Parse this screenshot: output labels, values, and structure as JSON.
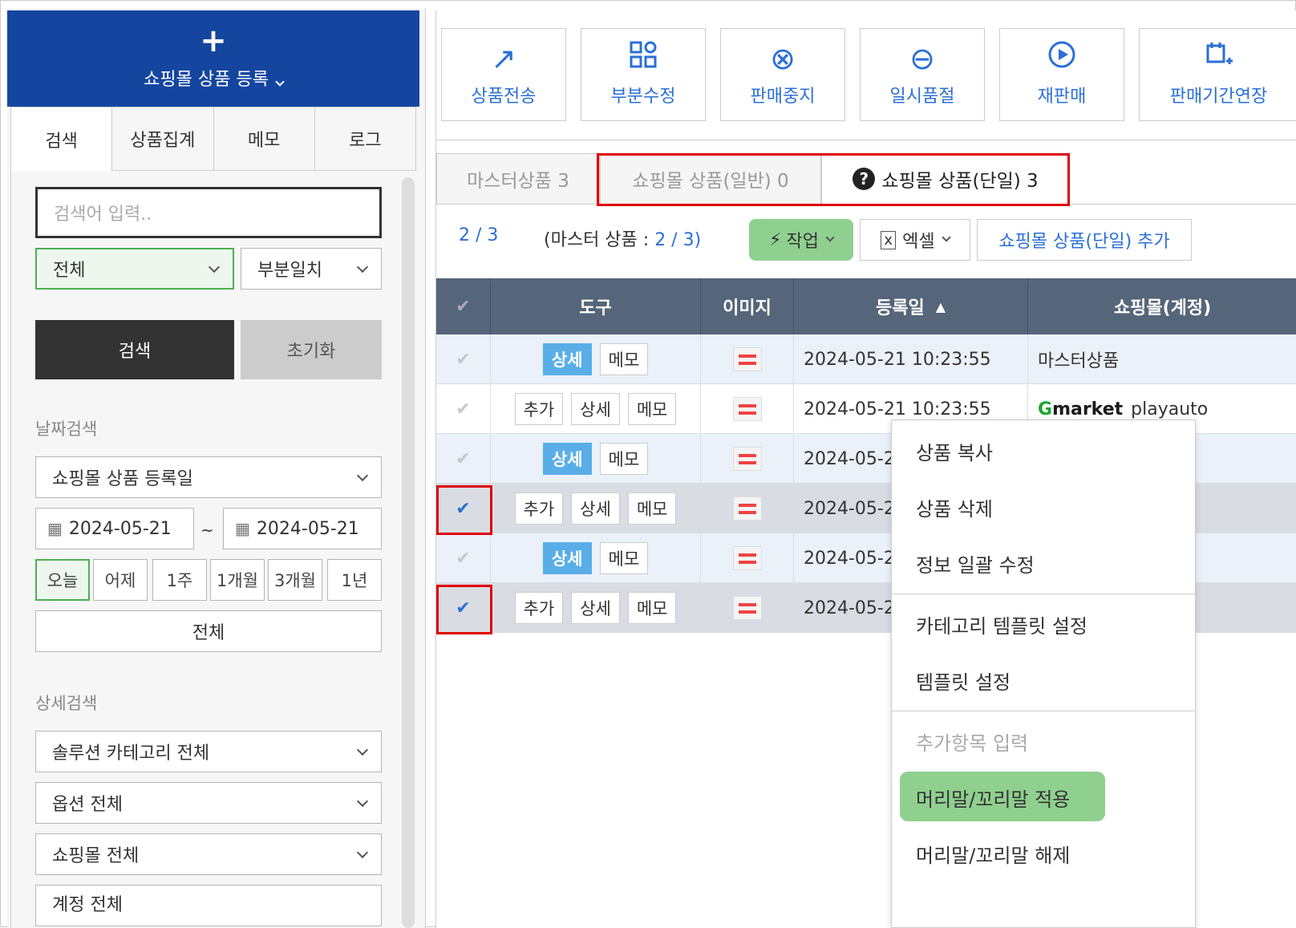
{
  "left": {
    "register_icon": "plus-icon",
    "register_label": "쇼핑몰 상품 등록",
    "tabs": [
      "검색",
      "상품집계",
      "메모",
      "로그"
    ],
    "search_placeholder": "검색어 입력..",
    "select_scope": "전체",
    "select_match": "부분일치",
    "btn_search": "검색",
    "btn_reset": "초기화",
    "date_section": "날짜검색",
    "date_type": "쇼핑몰 상품 등록일",
    "date_from": "2024-05-21",
    "date_sep": "~",
    "date_to": "2024-05-21",
    "quick_dates": [
      "오늘",
      "어제",
      "1주",
      "1개월",
      "3개월",
      "1년"
    ],
    "quick_all": "전체",
    "detail_section": "상세검색",
    "filters": [
      "솔루션 카테고리 전체",
      "옵션 전체",
      "쇼핑몰 전체",
      "계정 전체"
    ]
  },
  "toolbar": [
    {
      "label": "상품전송",
      "icon": "arrow-up-right-icon"
    },
    {
      "label": "부분수정",
      "icon": "grid-edit-icon"
    },
    {
      "label": "판매중지",
      "icon": "circle-x-icon"
    },
    {
      "label": "일시품절",
      "icon": "circle-minus-icon"
    },
    {
      "label": "재판매",
      "icon": "circle-play-icon"
    },
    {
      "label": "판매기간연장",
      "icon": "calendar-plus-icon"
    }
  ],
  "product_tabs": [
    "마스터상품 3",
    "쇼핑몰 상품(일반) 0",
    "쇼핑몰 상품(단일) 3"
  ],
  "info": {
    "count": "2 / 3",
    "master_prefix": "(마스터 상품 : ",
    "master_count": "2 / 3)",
    "work": "작업",
    "excel": "엑셀",
    "add_single": "쇼핑몰 상품(단일) 추가"
  },
  "table": {
    "headers": [
      "도구",
      "이미지",
      "등록일",
      "쇼핑몰(계정)"
    ],
    "btn_add": "추가",
    "btn_detail": "상세",
    "btn_memo": "메모",
    "rows": [
      {
        "date": "2024-05-21 10:23:55",
        "mall": "마스터상품",
        "checked": false
      },
      {
        "date": "2024-05-21 10:23:55",
        "mall_logo": "market",
        "mall_logo_g": "G",
        "mall_account": "playauto",
        "checked": false
      },
      {
        "date": "2024-05-21",
        "checked": false
      },
      {
        "date": "2024-05-21",
        "checked": true
      },
      {
        "date": "2024-05-21",
        "checked": false
      },
      {
        "date": "2024-05-21",
        "checked": true
      }
    ]
  },
  "menu": {
    "items": [
      "상품 복사",
      "상품 삭제",
      "정보 일괄 수정",
      "카테고리 템플릿 설정",
      "템플릿 설정",
      "추가항목 입력",
      "머리말/꼬리말 적용",
      "머리말/꼬리말 해제"
    ]
  },
  "colors": {
    "primary": "#1446a0",
    "accent": "#2b6fd6",
    "highlight": "#8fd08f",
    "header": "#55657a",
    "alert": "#e00000"
  }
}
